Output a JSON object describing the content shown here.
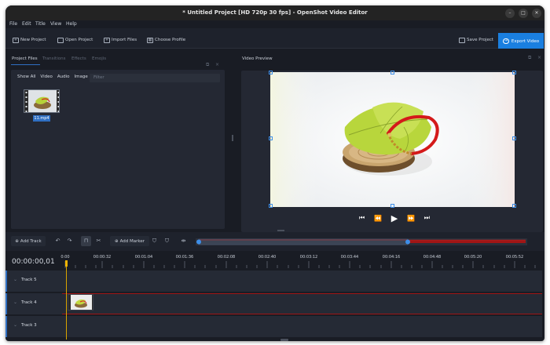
{
  "window": {
    "title": "* Untitled Project [HD 720p 30 fps] - OpenShot Video Editor",
    "controls": [
      "–",
      "□",
      "✕"
    ]
  },
  "menu": [
    "File",
    "Edit",
    "Title",
    "View",
    "Help"
  ],
  "toolbar": {
    "new_project": "New Project",
    "open_project": "Open Project",
    "import_files": "Import Files",
    "choose_profile": "Choose Profile",
    "save_project": "Save Project",
    "export_video": "Export Video"
  },
  "left_tabs": [
    "Project Files",
    "Transitions",
    "Effects",
    "Emojis"
  ],
  "file_filters": [
    "Show All",
    "Video",
    "Audio",
    "Image"
  ],
  "filter_placeholder": "Filter",
  "project_files": [
    {
      "name": "11.mp4"
    }
  ],
  "preview": {
    "title": "Video Preview"
  },
  "player": {
    "jump_start": "⏮",
    "rewind": "⏪",
    "play": "▶",
    "fast_forward": "⏩",
    "jump_end": "⏭"
  },
  "timeline_toolbar": {
    "add_track": "Add Track",
    "add_marker": "Add Marker"
  },
  "timeline": {
    "timecode": "00:00:00,01",
    "ruler_labels": [
      "0:00",
      "00:00:32",
      "00:01:04",
      "00:01:36",
      "00:02:08",
      "00:02:40",
      "00:03:12",
      "00:03:44",
      "00:04:16",
      "00:04:48",
      "00:05:20",
      "00:05:52"
    ],
    "tracks": [
      {
        "name": "Track 5"
      },
      {
        "name": "Track 4"
      },
      {
        "name": "Track 3"
      }
    ]
  },
  "colors": {
    "accent": "#1a7fe0",
    "background": "#191c24",
    "panel": "#242833",
    "playhead": "#f0b400",
    "selection": "#2f6fc2"
  }
}
